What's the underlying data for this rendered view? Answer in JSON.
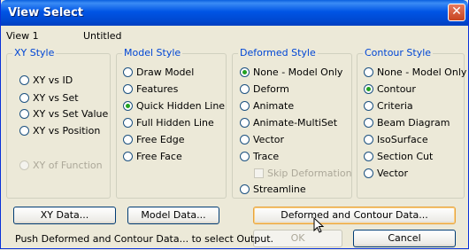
{
  "window": {
    "title": "View Select",
    "close_glyph": "✕"
  },
  "header": {
    "view_label": "View 1",
    "view_name": "Untitled"
  },
  "groups": {
    "xy_style": {
      "label": "XY Style",
      "options": [
        {
          "label": "XY vs ID",
          "selected": false,
          "enabled": true
        },
        {
          "label": "XY vs Set",
          "selected": false,
          "enabled": true
        },
        {
          "label": "XY vs Set Value",
          "selected": false,
          "enabled": true
        },
        {
          "label": "XY vs Position",
          "selected": false,
          "enabled": true
        },
        {
          "label": "XY of Function",
          "selected": false,
          "enabled": false
        }
      ]
    },
    "model_style": {
      "label": "Model Style",
      "options": [
        {
          "label": "Draw Model",
          "selected": false,
          "enabled": true
        },
        {
          "label": "Features",
          "selected": false,
          "enabled": true
        },
        {
          "label": "Quick Hidden Line",
          "selected": true,
          "enabled": true
        },
        {
          "label": "Full Hidden Line",
          "selected": false,
          "enabled": true
        },
        {
          "label": "Free Edge",
          "selected": false,
          "enabled": true
        },
        {
          "label": "Free Face",
          "selected": false,
          "enabled": true
        }
      ]
    },
    "deformed_style": {
      "label": "Deformed Style",
      "options": [
        {
          "label": "None - Model Only",
          "selected": true,
          "enabled": true
        },
        {
          "label": "Deform",
          "selected": false,
          "enabled": true
        },
        {
          "label": "Animate",
          "selected": false,
          "enabled": true
        },
        {
          "label": "Animate-MultiSet",
          "selected": false,
          "enabled": true
        },
        {
          "label": "Vector",
          "selected": false,
          "enabled": true
        },
        {
          "label": "Trace",
          "selected": false,
          "enabled": true
        }
      ],
      "skip_deformation": {
        "label": "Skip Deformation",
        "checked": false,
        "enabled": false
      },
      "streamline": {
        "label": "Streamline",
        "selected": false,
        "enabled": true
      }
    },
    "contour_style": {
      "label": "Contour Style",
      "options": [
        {
          "label": "None - Model Only",
          "selected": false,
          "enabled": true
        },
        {
          "label": "Contour",
          "selected": true,
          "enabled": true
        },
        {
          "label": "Criteria",
          "selected": false,
          "enabled": true
        },
        {
          "label": "Beam Diagram",
          "selected": false,
          "enabled": true
        },
        {
          "label": "IsoSurface",
          "selected": false,
          "enabled": true
        },
        {
          "label": "Section Cut",
          "selected": false,
          "enabled": true
        },
        {
          "label": "Vector",
          "selected": false,
          "enabled": true
        }
      ]
    }
  },
  "buttons": {
    "xy_data": "XY Data...",
    "model_data": "Model Data...",
    "deformed_contour_data": "Deformed and Contour Data...",
    "ok": "OK",
    "cancel": "Cancel"
  },
  "status_text": "Push Deformed and Contour Data... to select Output.",
  "colors": {
    "title_bar": "#0055e5",
    "group_label": "#0046d5",
    "radio_selected": "#21a121"
  }
}
